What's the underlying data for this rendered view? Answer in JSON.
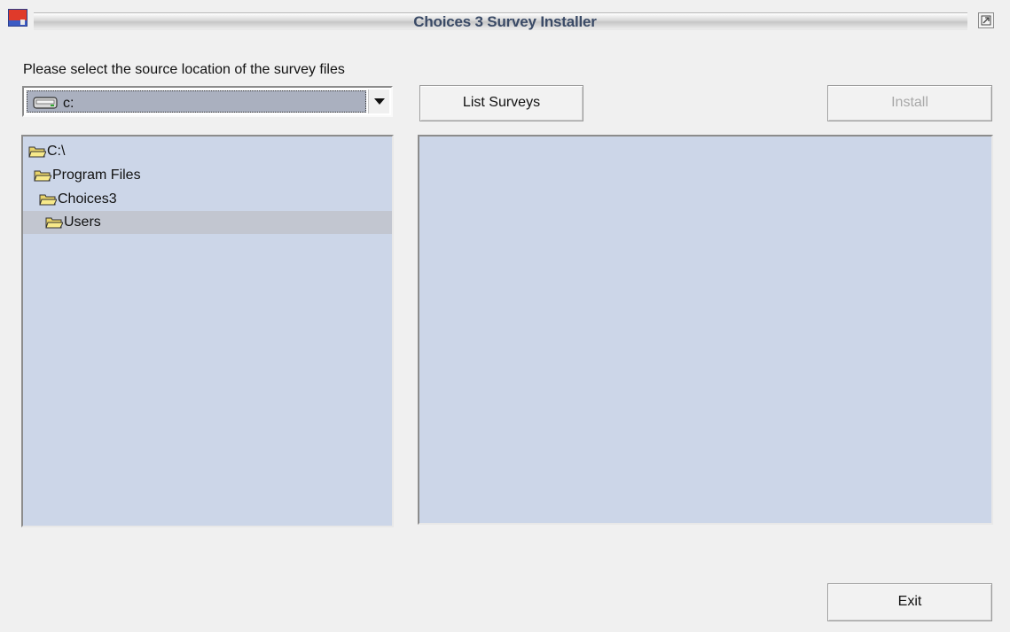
{
  "window": {
    "title": "Choices 3 Survey Installer",
    "icon": "app-icon",
    "restore_icon": "restore-icon"
  },
  "source": {
    "prompt": "Please select the source location of the survey files",
    "drive_value": "c:",
    "drive_icon": "drive-icon"
  },
  "buttons": {
    "list_surveys": "List Surveys",
    "install": "Install",
    "exit": "Exit"
  },
  "tree": {
    "items": [
      {
        "label": "C:\\",
        "icon": "folder-open-icon",
        "level": 0
      },
      {
        "label": "Program Files",
        "icon": "folder-open-icon",
        "level": 1
      },
      {
        "label": "Choices3",
        "icon": "folder-open-icon",
        "level": 2
      },
      {
        "label": "Users",
        "icon": "folder-open-icon",
        "level": 3,
        "selected": true
      }
    ]
  },
  "survey_list": {
    "items": []
  },
  "colors": {
    "panel_bg": "#ccd6e8",
    "selected_row": "#c2c6d0",
    "title_text": "#3a4a66",
    "disabled_text": "#a8a8a8"
  }
}
